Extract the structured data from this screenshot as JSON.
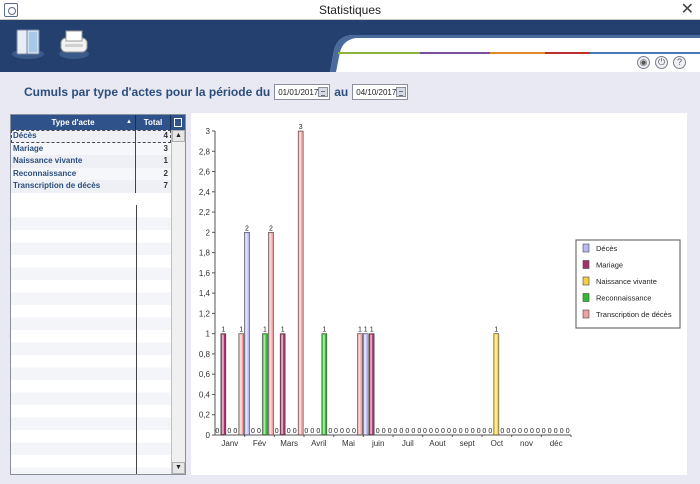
{
  "window": {
    "title": "Statistiques",
    "close_glyph": "✕"
  },
  "header": {
    "label_prefix": "Cumuls par type d'actes pour la période du",
    "date_from": "01/01/2017",
    "label_to": "au",
    "date_to": "04/10/2017"
  },
  "banner": {
    "icons": [
      "book-icon",
      "printer-icon",
      "eye-icon",
      "power-icon",
      "help-icon"
    ],
    "help_glyph": "?"
  },
  "table": {
    "columns": [
      "Type d'acte",
      "Total"
    ],
    "rows": [
      {
        "type": "Décès",
        "total": "4"
      },
      {
        "type": "Mariage",
        "total": "3"
      },
      {
        "type": "Naissance vivante",
        "total": "1"
      },
      {
        "type": "Reconnaissance",
        "total": "2"
      },
      {
        "type": "Transcription de décès",
        "total": "7"
      }
    ]
  },
  "chart_data": {
    "type": "bar",
    "categories": [
      "Janv",
      "Fév",
      "Mars",
      "Avril",
      "Mai",
      "juin",
      "Juil",
      "Aout",
      "sept",
      "Oct",
      "nov",
      "déc"
    ],
    "series": [
      {
        "name": "Décès",
        "color": "#b9b9f5",
        "values": [
          0,
          2,
          0,
          0,
          0,
          1,
          0,
          0,
          0,
          0,
          0,
          0
        ]
      },
      {
        "name": "Mariage",
        "color": "#a8306a",
        "values": [
          1,
          0,
          1,
          0,
          0,
          1,
          0,
          0,
          0,
          0,
          0,
          0
        ]
      },
      {
        "name": "Naissance vivante",
        "color": "#f5d040",
        "values": [
          0,
          0,
          0,
          0,
          0,
          0,
          0,
          0,
          0,
          1,
          0,
          0
        ]
      },
      {
        "name": "Reconnaissance",
        "color": "#2fbd2f",
        "values": [
          0,
          1,
          0,
          1,
          0,
          0,
          0,
          0,
          0,
          0,
          0,
          0
        ]
      },
      {
        "name": "Transcription de décès",
        "color": "#f0a0a0",
        "values": [
          1,
          2,
          3,
          0,
          1,
          0,
          0,
          0,
          0,
          0,
          0,
          0
        ]
      }
    ],
    "ylim": [
      0,
      3
    ],
    "yticks": [
      "0",
      "0,2",
      "0,4",
      "0,6",
      "0,8",
      "1",
      "1,2",
      "1,4",
      "1,6",
      "1,8",
      "2",
      "2,2",
      "2,4",
      "2,6",
      "2,8",
      "3"
    ],
    "legend_position": "right"
  }
}
